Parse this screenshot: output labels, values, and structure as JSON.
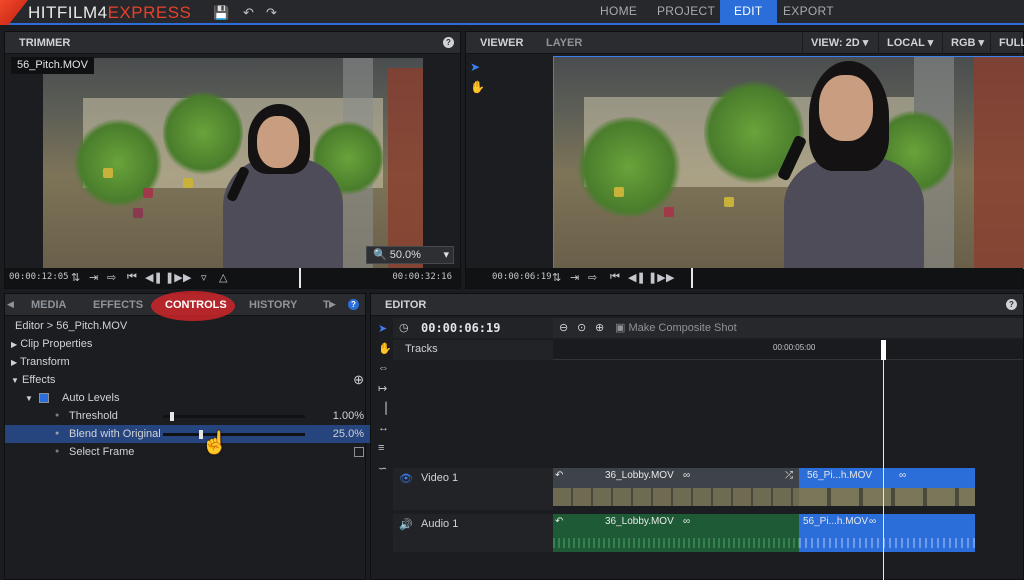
{
  "app": {
    "logo": "HITFILM4",
    "logo_accent": "EXPRESS",
    "nav": [
      "HOME",
      "PROJECT",
      "EDIT",
      "EXPORT"
    ],
    "active_nav": "EDIT"
  },
  "trimmer": {
    "tab": "TRIMMER",
    "file": "56_Pitch.MOV",
    "zoom": "50.0%",
    "tc_in": "00:00:12:05",
    "tc_dur": "00:00:32:16"
  },
  "viewer": {
    "tabs": [
      "VIEWER",
      "LAYER"
    ],
    "view": "VIEW: 2D",
    "space": "LOCAL",
    "channel": "RGB",
    "size": "FULL",
    "tc": "00:00:06:19"
  },
  "left_panel": {
    "tabs": [
      "MEDIA",
      "EFFECTS",
      "CONTROLS",
      "HISTORY",
      "T"
    ],
    "breadcrumb": "Editor > 56_Pitch.MOV",
    "items": {
      "clip_properties": "Clip Properties",
      "transform": "Transform",
      "effects": "Effects",
      "auto_levels": "Auto Levels",
      "threshold": "Threshold",
      "threshold_value": "1.00%",
      "blend": "Blend with Original",
      "blend_value": "25.0%",
      "select_frame": "Select Frame"
    },
    "threshold_level": 0.05,
    "blend_level": 0.25
  },
  "editor": {
    "tab": "EDITOR",
    "tc": "00:00:06:19",
    "composite": "Make Composite Shot",
    "tracks_label": "Tracks",
    "ruler_mark": "00:00:05:00",
    "video_track": "Video 1",
    "audio_track": "Audio 1",
    "clips": {
      "v1": "36_Lobby.MOV",
      "v2": "56_Pi...h.MOV",
      "a1": "36_Lobby.MOV",
      "a2": "56_Pi...h.MOV"
    }
  },
  "colors": {
    "accent": "#2b6ed9",
    "highlight_ring": "#d8262b",
    "audio_clip": "#1f5a36"
  }
}
